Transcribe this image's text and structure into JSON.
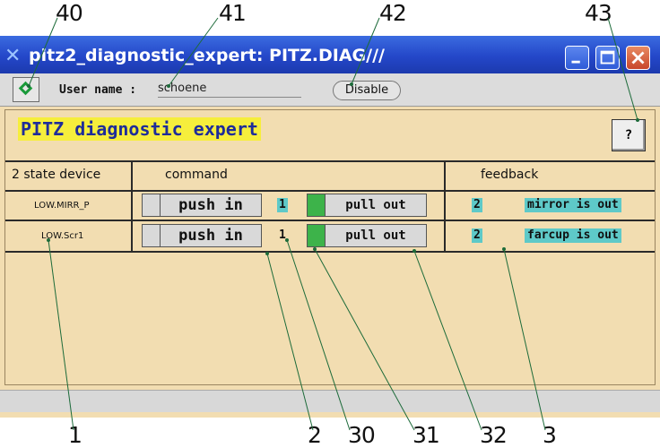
{
  "callouts": {
    "top": [
      "40",
      "41",
      "42",
      "43"
    ],
    "bottom": [
      "1",
      "2",
      "30",
      "31",
      "32",
      "3"
    ]
  },
  "window": {
    "title": "pitz2_diagnostic_expert: PITZ.DIAG///",
    "app_icon": "x-logo-icon",
    "controls": [
      "minimize-icon",
      "maximize-icon",
      "close-icon"
    ]
  },
  "toolbar": {
    "username_label": "User name :",
    "username_value": "schoene",
    "disable_label": "Disable"
  },
  "panel": {
    "title": "PITZ diagnostic expert",
    "help_label": "?"
  },
  "table": {
    "headers": {
      "device": "2 state device",
      "command": "command",
      "feedback": "feedback"
    },
    "rows": [
      {
        "device": "LOW.MIRR_P",
        "push_label": "push in",
        "push_value": "1",
        "pull_label": "pull out",
        "feedback_value": "2",
        "feedback_text": "mirror is out"
      },
      {
        "device": "LOW.Scr1",
        "push_label": "push in",
        "push_value": "1",
        "pull_label": "pull out",
        "feedback_value": "2",
        "feedback_text": "farcup is out"
      }
    ]
  },
  "colors": {
    "background": "#F2DDB1",
    "heading_highlight": "#F6EE3C",
    "heading_text": "#1E2C9A",
    "value_cell": "#5EC9C8",
    "pull_lamp": "#3DB34A"
  }
}
